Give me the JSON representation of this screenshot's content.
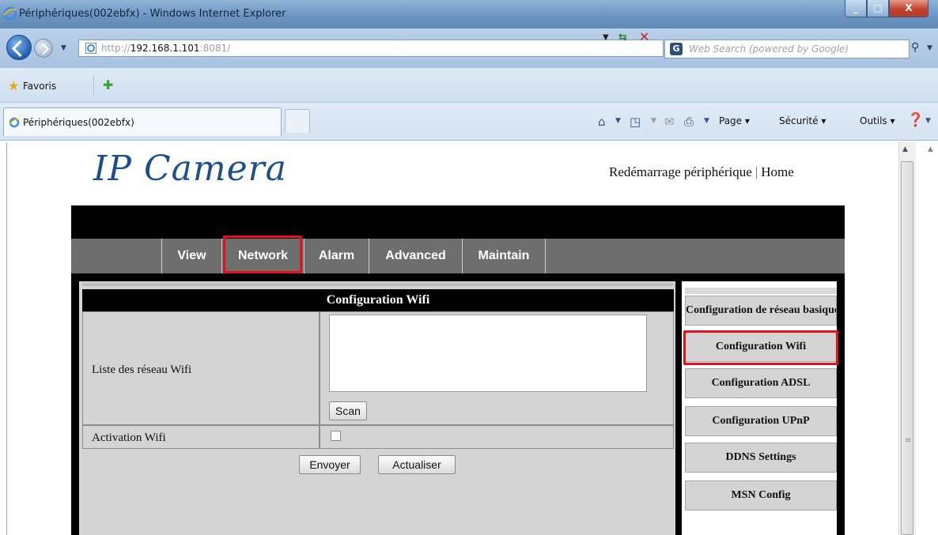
{
  "window": {
    "title": "Périphériques(002ebfx) - Windows Internet Explorer"
  },
  "addressbar": {
    "url_scheme": "http://",
    "url_host": "192.168.1.101",
    "url_rest": ":8081/",
    "search_placeholder": "Web Search (powered by Google)"
  },
  "favorites": {
    "label": "Favoris"
  },
  "tab": {
    "title": "Périphériques(002ebfx)"
  },
  "commandbar": {
    "page": "Page ▾",
    "security": "Sécurité ▾",
    "tools": "Outils ▾"
  },
  "camera": {
    "logo": "IP Camera",
    "links": [
      "Redémarrage périphérique",
      "Home"
    ],
    "menu": [
      "View",
      "Network",
      "Alarm",
      "Advanced",
      "Maintain"
    ],
    "active_menu": "Network",
    "panel": {
      "title": "Configuration Wifi",
      "wifi_list_label": "Liste des réseau Wifi",
      "scan_button": "Scan",
      "activation_label": "Activation Wifi",
      "activation_checked": false,
      "send_button": "Envoyer",
      "refresh_button": "Actualiser"
    },
    "side_menu": [
      "Configuration de réseau basique",
      "Configuration Wifi",
      "Configuration ADSL",
      "Configuration UPnP",
      "DDNS Settings",
      "MSN Config"
    ],
    "active_side_item": "Configuration Wifi",
    "highlight_color": "#e4101a"
  }
}
